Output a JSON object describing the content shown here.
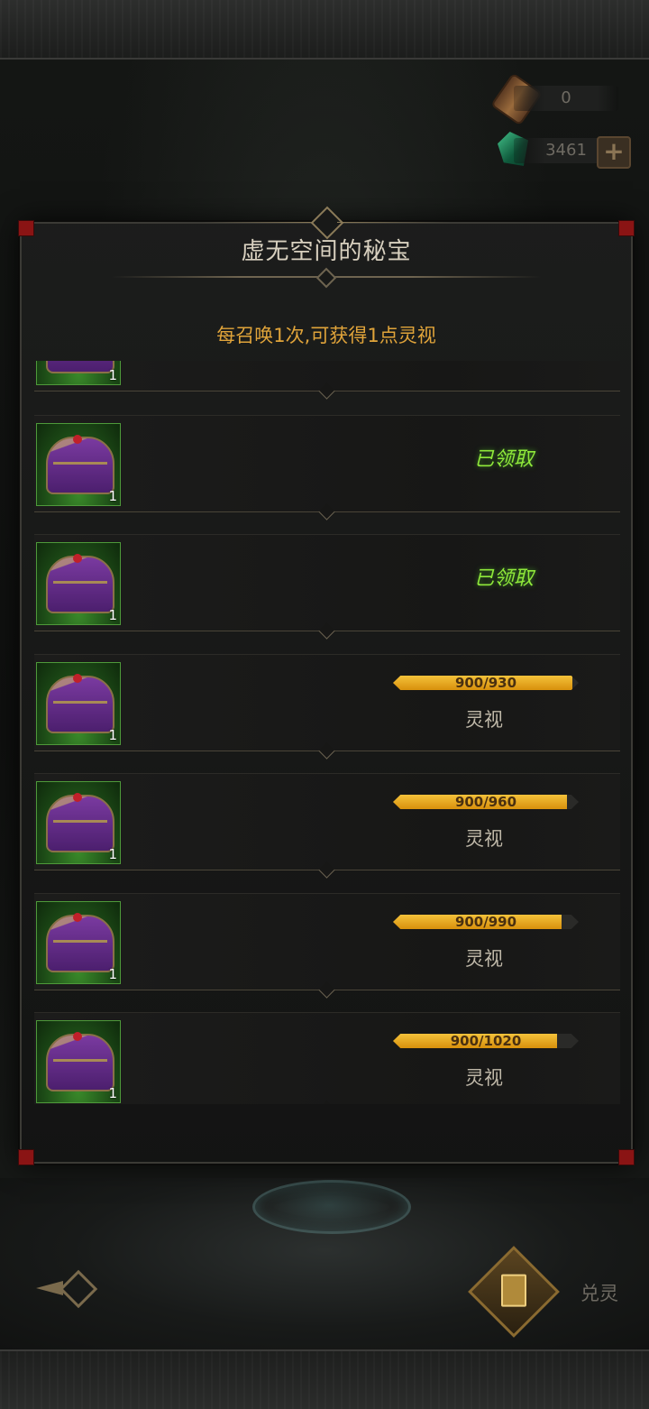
{
  "currencies": [
    {
      "icon": "scroll-icon",
      "value": "0"
    },
    {
      "icon": "gem-icon",
      "value": "3461"
    }
  ],
  "add_currency_label": "+",
  "modal": {
    "title": "虚无空间的秘宝",
    "subtitle": "每召唤1次,可获得1点灵视"
  },
  "rewards": [
    {
      "count": "1",
      "status": "claimed",
      "status_text": ""
    },
    {
      "count": "1",
      "status": "claimed",
      "status_text": "已领取"
    },
    {
      "count": "1",
      "status": "claimed",
      "status_text": "已领取"
    },
    {
      "count": "1",
      "status": "progress",
      "progress_text": "900/930",
      "progress": 0.968,
      "unit": "灵视"
    },
    {
      "count": "1",
      "status": "progress",
      "progress_text": "900/960",
      "progress": 0.9375,
      "unit": "灵视"
    },
    {
      "count": "1",
      "status": "progress",
      "progress_text": "900/990",
      "progress": 0.909,
      "unit": "灵视"
    },
    {
      "count": "1",
      "status": "progress",
      "progress_text": "900/1020",
      "progress": 0.882,
      "unit": "灵视"
    }
  ],
  "bottom_nav": {
    "card_label": "兑灵"
  },
  "colors": {
    "accent_gold": "#e0a43a",
    "claimed_green": "#8fe83a",
    "progress_fill": "#f4c23a"
  }
}
